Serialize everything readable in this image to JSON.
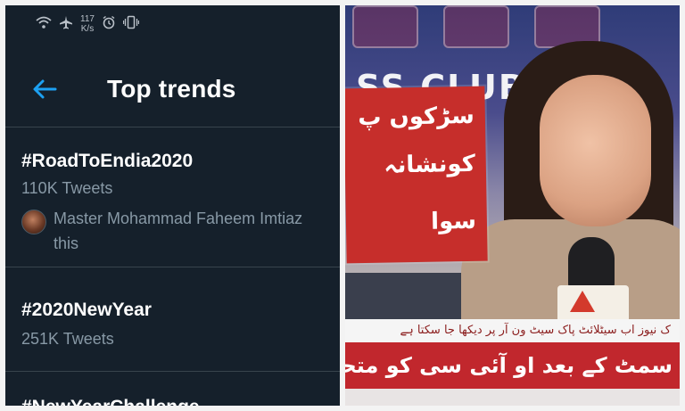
{
  "status_bar": {
    "wifi_icon": "wifi-icon",
    "airplane_icon": "airplane-icon",
    "network_speed_value": "117",
    "network_speed_unit": "K/s",
    "alarm_icon": "alarm-icon",
    "vibrate_icon": "vibrate-icon"
  },
  "header": {
    "back_icon": "arrow-left-icon",
    "title": "Top trends",
    "accent_color": "#1da1f2"
  },
  "trends": [
    {
      "name": "#RoadToEndia2020",
      "count": "110K Tweets",
      "context_line1": "Master Mohammad Faheem Imtiaz",
      "context_line2": "this"
    },
    {
      "name": "#2020NewYear",
      "count": "251K Tweets"
    },
    {
      "name": "#NewYearChallenge"
    }
  ],
  "photo": {
    "backdrop_text": "SS CLUB",
    "placard_lines": [
      "سڑکوں پ",
      "کونشانہ",
      "سوا"
    ],
    "ticker_top": "ک نیوز اب سیٹلائٹ پاک سیٹ ون آر پر دیکھا جا سکتا ہے",
    "ticker_main": "سمٹ کے بعد او آئی سی کو متحرک کرنے کا فیصلہ کیا، ذرا"
  },
  "colors": {
    "app_background": "#15202b",
    "divider": "#38444d",
    "secondary_text": "#8899a6",
    "ticker_red": "#c1272d"
  }
}
